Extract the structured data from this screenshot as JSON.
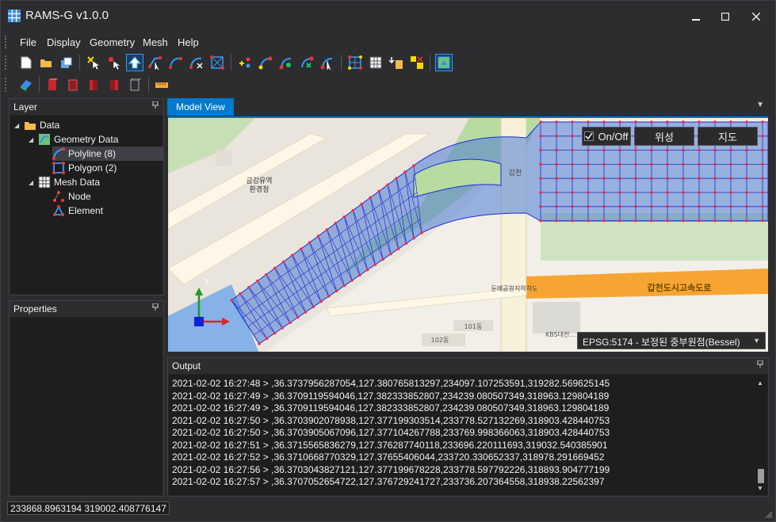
{
  "app": {
    "title": "RAMS-G v1.0.0"
  },
  "window_controls": {
    "minimize": "▁",
    "maximize": "☐",
    "close": "✕"
  },
  "menu": [
    "File",
    "Display",
    "Geometry",
    "Mesh",
    "Help"
  ],
  "toolbar1": {
    "groups": [
      [
        "new-file-icon",
        "open-folder-icon",
        "save-icon"
      ],
      [
        "add-point-icon",
        "move-point-icon",
        "select-arrow-icon",
        "edit-line-icon",
        "polyline-icon",
        "polyline-edit-icon",
        "mesh-grid-icon"
      ],
      [
        "add-node-icon",
        "node-line-icon",
        "node-edit-icon",
        "node-move-icon",
        "node-select-icon"
      ],
      [
        "mesh-generate-icon",
        "grid-icon",
        "import-icon",
        "export-icon"
      ],
      [
        "map-layer-icon"
      ]
    ],
    "active": "select-arrow-icon"
  },
  "toolbar2": {
    "icons": [
      "layers-icon",
      "box-red-icon",
      "box-red-2-icon",
      "box-red-3-icon",
      "box-red-4-icon",
      "box-gray-icon",
      "ruler-icon"
    ]
  },
  "layer_panel": {
    "title": "Layer",
    "pin": "📌",
    "tree": [
      {
        "label": "Data",
        "level": 0,
        "icon": "folder-icon",
        "expanded": true
      },
      {
        "label": "Geometry Data",
        "level": 1,
        "icon": "geometry-data-icon",
        "expanded": true
      },
      {
        "label": "Polyline (8)",
        "level": 2,
        "icon": "polyline-icon",
        "selected": true
      },
      {
        "label": "Polygon (2)",
        "level": 2,
        "icon": "polygon-icon"
      },
      {
        "label": "Mesh Data",
        "level": 1,
        "icon": "mesh-data-icon",
        "expanded": true
      },
      {
        "label": "Node",
        "level": 2,
        "icon": "node-icon"
      },
      {
        "label": "Element",
        "level": 2,
        "icon": "element-icon"
      }
    ]
  },
  "properties_panel": {
    "title": "Properties"
  },
  "model_view": {
    "tab": "Model View",
    "onoff_label": "On/Off",
    "onoff_checked": true,
    "satellite_label": "위성",
    "map_label": "지도",
    "crs": "EPSG:5174 - 보정된 중부원점(Bessel)",
    "map_labels": {
      "station": "금강유역\n환경청",
      "gapcheon": "갑천",
      "expressway": "갑천도시고속도로",
      "underpass": "둔매공원지하차도",
      "bldg101": "101동",
      "bldg102": "102동",
      "kbs": "KBS대전..."
    },
    "axis": {
      "y": "Y",
      "x": "X"
    },
    "colors": {
      "mesh": "#1f2bd6",
      "mesh_fill": "#4d7bd6",
      "node": "#ff2a3a",
      "water": "#86b2e8",
      "road": "#f7a532",
      "land": "#f2efe9",
      "park": "#b7dba1"
    }
  },
  "output_panel": {
    "title": "Output",
    "lines": [
      "2021-02-02 16:27:48 > ,36.3737956287054,127.380765813297,234097.107253591,319282.569625145",
      "2021-02-02 16:27:49 > ,36.3709119594046,127.382333852807,234239.080507349,318963.129804189",
      "2021-02-02 16:27:49 > ,36.3709119594046,127.382333852807,234239.080507349,318963.129804189",
      "2021-02-02 16:27:50 > ,36.3703902078938,127.377199303514,233778.527132269,318903.428440753",
      "2021-02-02 16:27:50 > ,36.3703905067096,127.377104267788,233769.998366063,318903.428440753",
      "2021-02-02 16:27:51 > ,36.3715565836279,127.376287740118,233696.220111693,319032.540385901",
      "2021-02-02 16:27:52 > ,36.3710668770329,127.37655406044,233720.330652337,318978.291669452",
      "2021-02-02 16:27:56 > ,36.3703043827121,127.377199678228,233778.597792226,318893.904777199",
      "2021-02-02 16:27:57 > ,36.3707052654722,127.376729241727,233736.207364558,318938.22562397"
    ]
  },
  "status": {
    "coords": "233868.8963194 319002.408776147"
  }
}
